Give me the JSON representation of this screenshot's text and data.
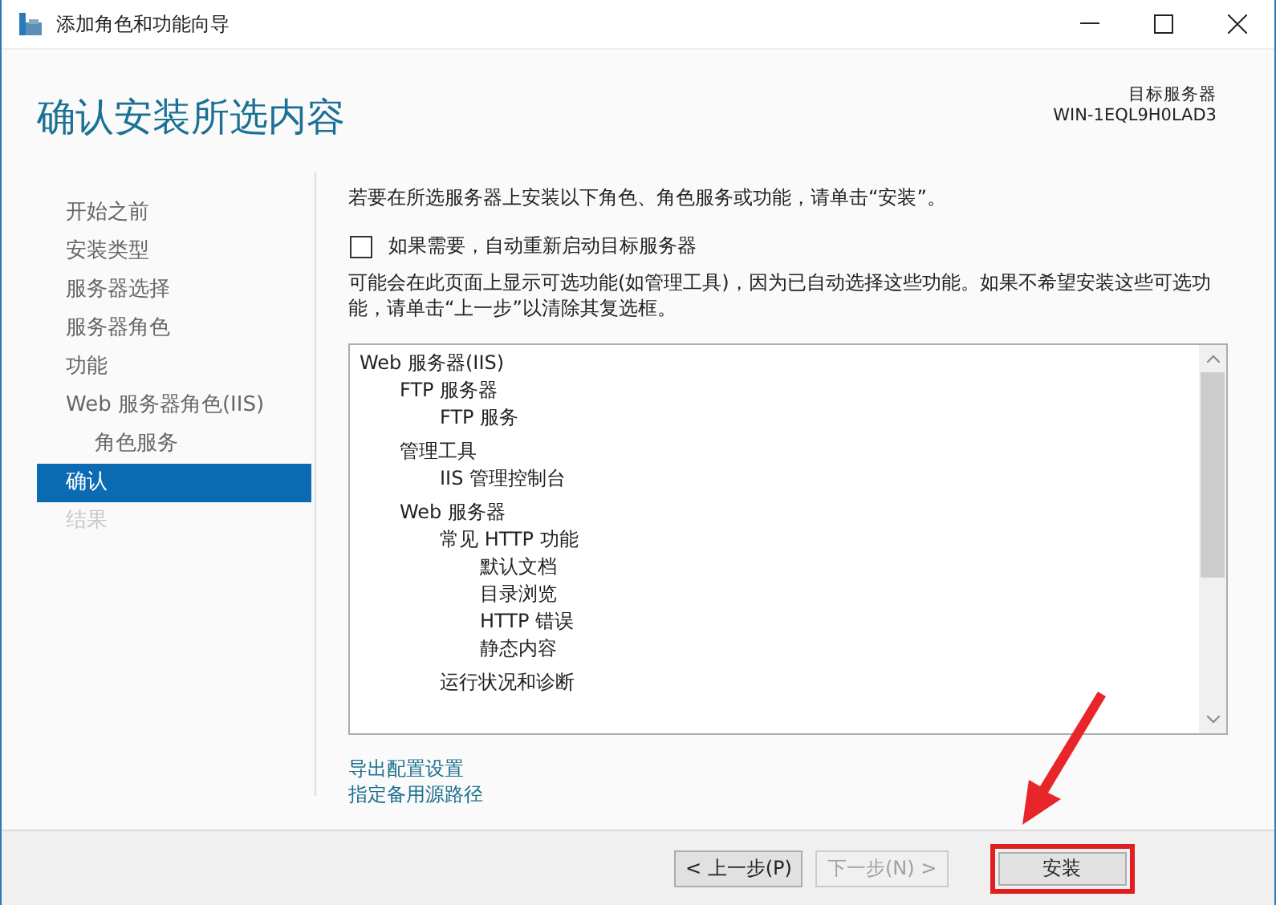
{
  "window": {
    "title": "添加角色和功能向导"
  },
  "header": {
    "title": "确认安装所选内容",
    "server_label": "目标服务器",
    "server_name": "WIN-1EQL9H0LAD3"
  },
  "sidebar": {
    "items": [
      {
        "label": "开始之前",
        "selected": false,
        "disabled": false
      },
      {
        "label": "安装类型",
        "selected": false,
        "disabled": false
      },
      {
        "label": "服务器选择",
        "selected": false,
        "disabled": false
      },
      {
        "label": "服务器角色",
        "selected": false,
        "disabled": false
      },
      {
        "label": "功能",
        "selected": false,
        "disabled": false
      },
      {
        "label": "Web 服务器角色(IIS)",
        "selected": false,
        "disabled": false,
        "children": [
          {
            "label": "角色服务",
            "selected": false,
            "disabled": false
          }
        ]
      },
      {
        "label": "确认",
        "selected": true,
        "disabled": false
      },
      {
        "label": "结果",
        "selected": false,
        "disabled": true
      }
    ]
  },
  "content": {
    "instruction": "若要在所选服务器上安装以下角色、角色服务或功能，请单击“安装”。",
    "restart_checkbox": {
      "label": "如果需要，自动重新启动目标服务器",
      "checked": false
    },
    "note": "可能会在此页面上显示可选功能(如管理工具)，因为已自动选择这些功能。如果不希望安装这些可选功能，请单击“上一步”以清除其复选框。",
    "tree": [
      {
        "label": "Web 服务器(IIS)",
        "children": [
          {
            "label": "FTP 服务器",
            "children": [
              {
                "label": "FTP 服务"
              }
            ]
          },
          {
            "label": "管理工具",
            "children": [
              {
                "label": "IIS 管理控制台"
              }
            ]
          },
          {
            "label": "Web 服务器",
            "children": [
              {
                "label": "常见 HTTP 功能",
                "children": [
                  {
                    "label": "默认文档"
                  },
                  {
                    "label": "目录浏览"
                  },
                  {
                    "label": "HTTP 错误"
                  },
                  {
                    "label": "静态内容"
                  }
                ]
              },
              {
                "label": "运行状况和诊断"
              }
            ]
          }
        ]
      }
    ],
    "links": [
      "导出配置设置",
      "指定备用源路径"
    ]
  },
  "footer": {
    "buttons": [
      {
        "label": "< 上一步(P)",
        "disabled": false,
        "highlighted": false
      },
      {
        "label": "下一步(N) >",
        "disabled": true,
        "highlighted": false
      },
      {
        "label": "安装",
        "disabled": false,
        "highlighted": true
      }
    ]
  }
}
